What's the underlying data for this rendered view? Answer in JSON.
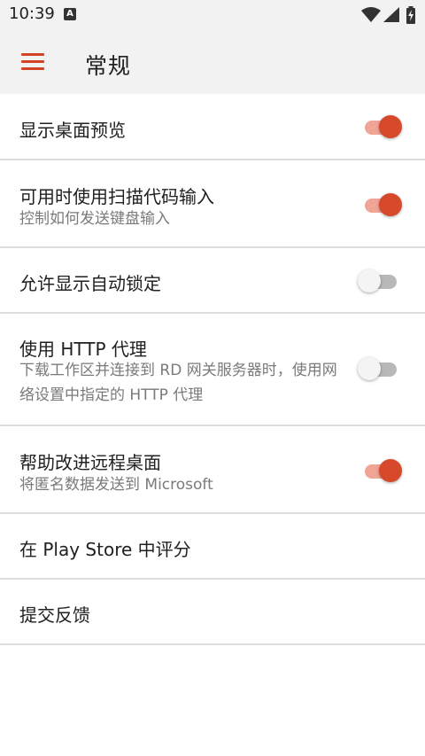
{
  "status_bar": {
    "time": "10:39",
    "notification_icon": "a-notification-icon",
    "icons": [
      "wifi-icon",
      "signal-icon",
      "battery-charging-icon"
    ]
  },
  "toolbar": {
    "menu_icon": "hamburger-menu-icon",
    "title": "常规"
  },
  "colors": {
    "accent": "#d14324",
    "switch_on_thumb": "#d6492a",
    "switch_on_track": "#f0a596",
    "switch_off_thumb": "#f4f4f4",
    "switch_off_track": "#b8b8b8",
    "header_bg": "#f2f2f2",
    "divider": "#dddddd"
  },
  "settings": [
    {
      "title": "显示桌面预览",
      "summary": "",
      "toggle": true
    },
    {
      "title": "可用时使用扫描代码输入",
      "summary": "控制如何发送键盘输入",
      "toggle": true
    },
    {
      "title": "允许显示自动锁定",
      "summary": "",
      "toggle": false
    },
    {
      "title": "使用 HTTP 代理",
      "summary": "下载工作区并连接到 RD 网关服务器时，使用网络设置中指定的 HTTP 代理",
      "toggle": false
    },
    {
      "title": "帮助改进远程桌面",
      "summary": "将匿名数据发送到 Microsoft",
      "toggle": true
    },
    {
      "title": "在 Play Store 中评分",
      "summary": "",
      "toggle": null
    },
    {
      "title": "提交反馈",
      "summary": "",
      "toggle": null
    }
  ]
}
